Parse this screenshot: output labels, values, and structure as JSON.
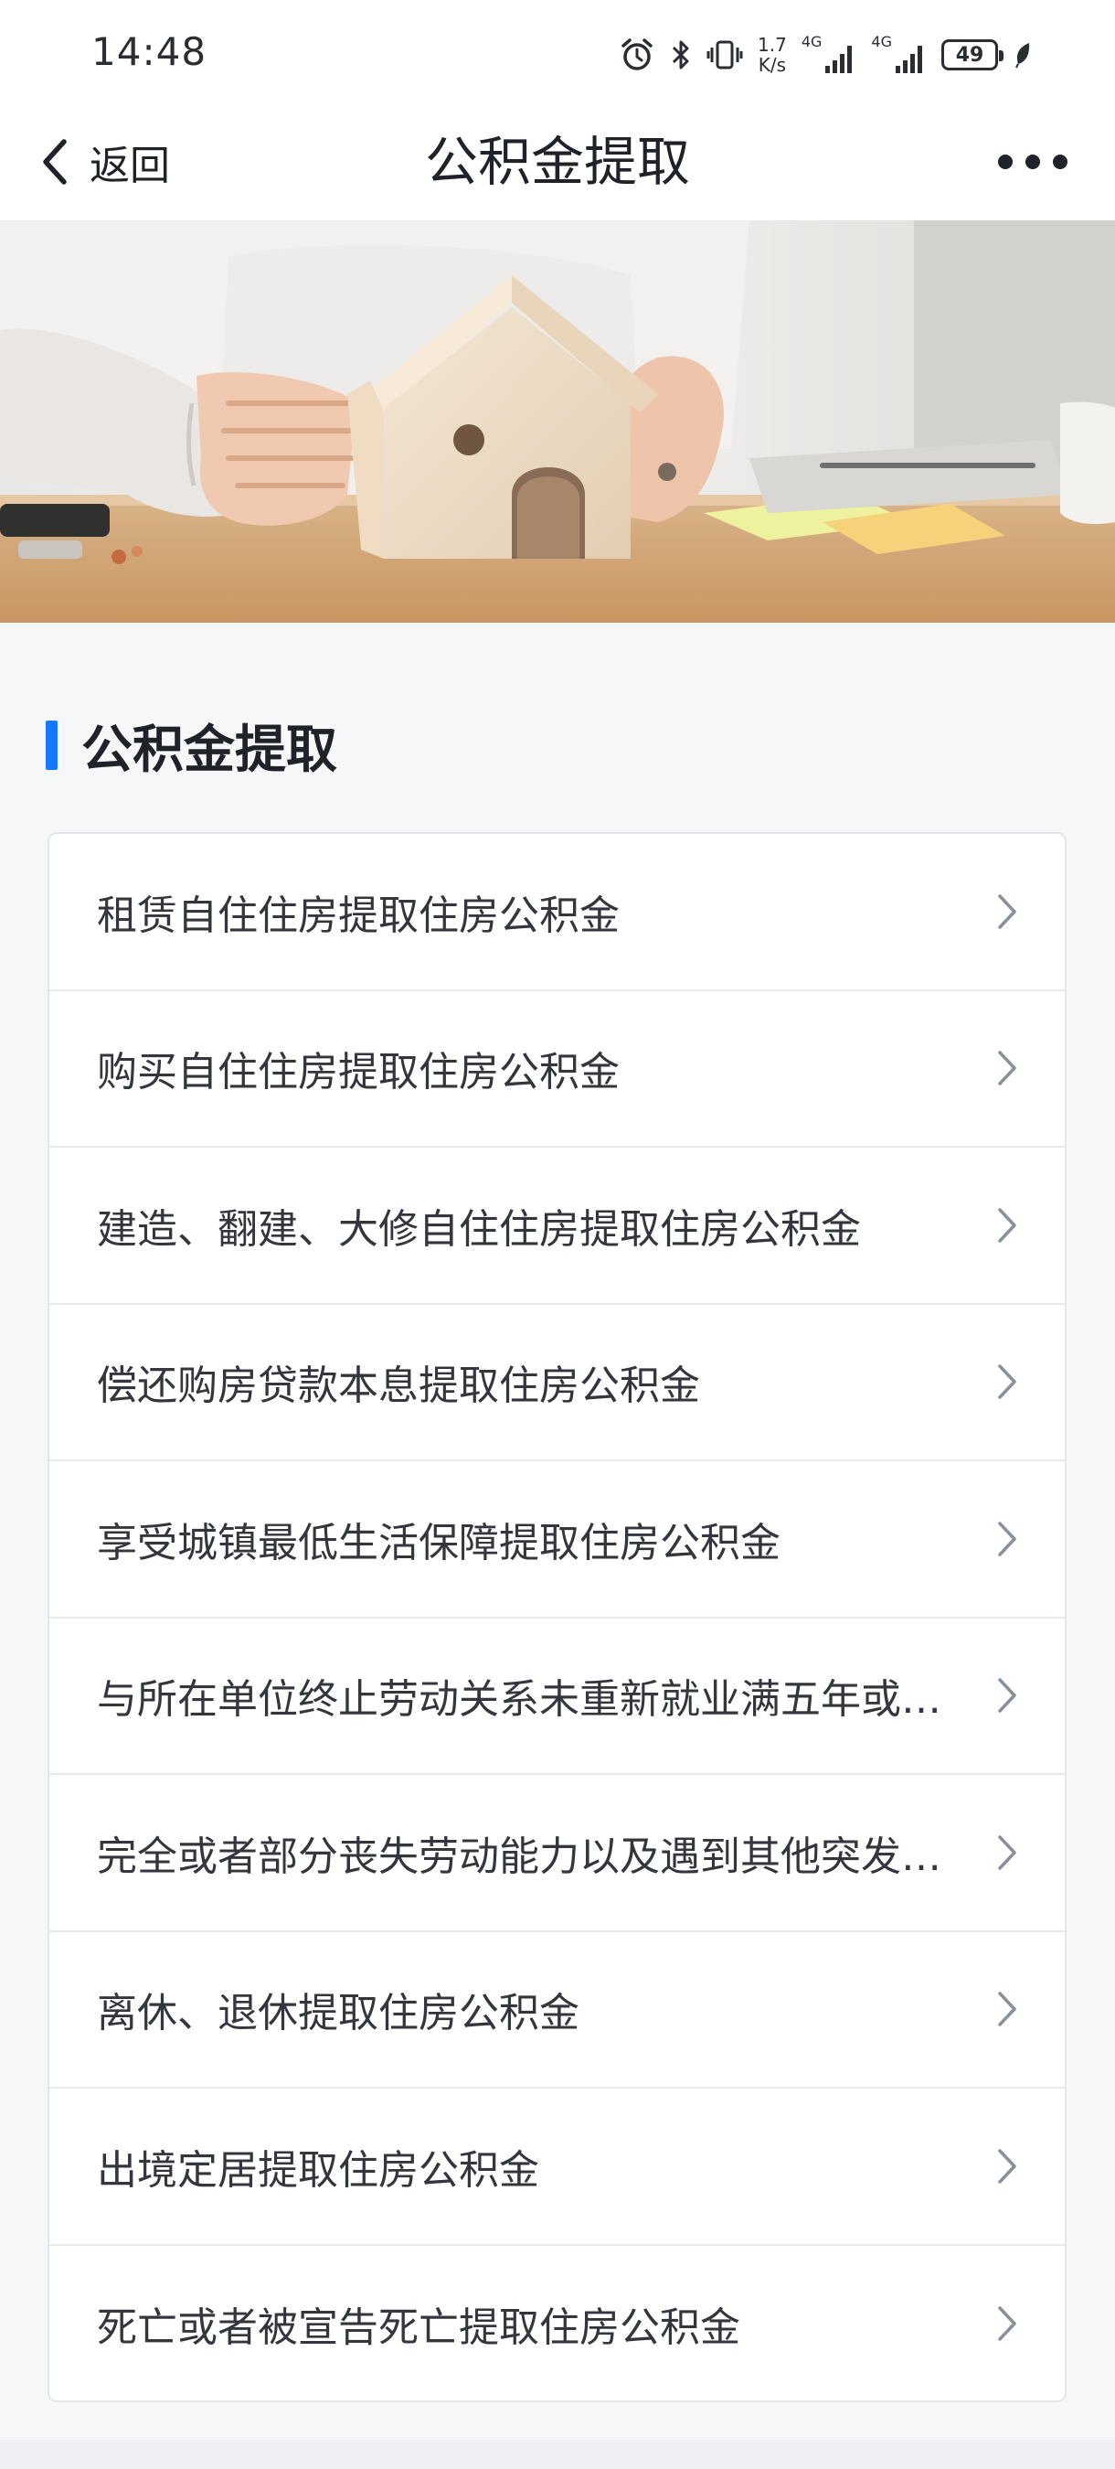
{
  "status_bar": {
    "time": "14:48",
    "speed_value": "1.7",
    "speed_unit": "K/s",
    "network_1": "4G",
    "network_2": "4G",
    "battery": "49"
  },
  "nav": {
    "back_label": "返回",
    "title": "公积金提取"
  },
  "section": {
    "heading": "公积金提取"
  },
  "list": {
    "items": [
      "租赁自住住房提取住房公积金",
      "购买自住住房提取住房公积金",
      "建造、翻建、大修自住住房提取住房公积金",
      "偿还购房贷款本息提取住房公积金",
      "享受城镇最低生活保障提取住房公积金",
      "与所在单位终止劳动关系未重新就业满五年或…",
      "完全或者部分丧失劳动能力以及遇到其他突发…",
      "离休、退休提取住房公积金",
      "出境定居提取住房公积金",
      "死亡或者被宣告死亡提取住房公积金"
    ]
  },
  "icons": {
    "back": "chevron-left-icon",
    "more": "more-dots-icon",
    "list_arrow": "chevron-right-icon"
  },
  "colors": {
    "accent": "#1677ff",
    "background": "#f6f7f9"
  }
}
